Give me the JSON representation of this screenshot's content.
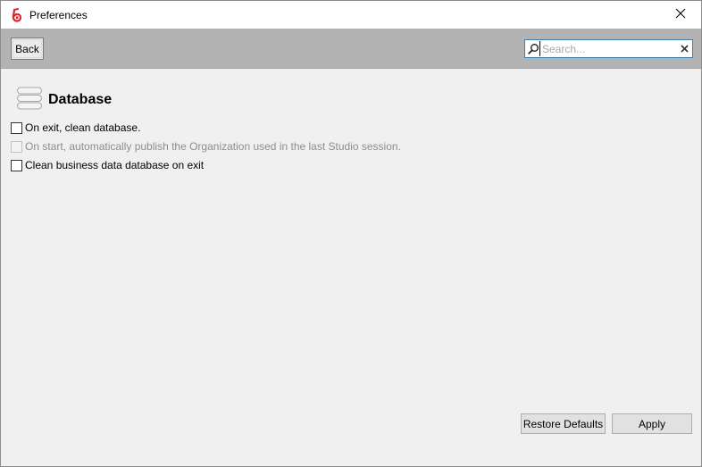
{
  "window": {
    "title": "Preferences"
  },
  "toolbar": {
    "back_label": "Back",
    "search": {
      "placeholder": "Search...",
      "value": ""
    }
  },
  "page": {
    "title": "Database",
    "options": [
      {
        "label": "On exit, clean database.",
        "checked": false,
        "enabled": true
      },
      {
        "label": "On start, automatically publish the Organization used in the last Studio session.",
        "checked": false,
        "enabled": false
      },
      {
        "label": "Clean business data database on exit",
        "checked": false,
        "enabled": true
      }
    ]
  },
  "footer": {
    "restore_label": "Restore Defaults",
    "apply_label": "Apply"
  },
  "icons": {
    "app": "bonita-logo-icon",
    "close": "close-icon",
    "search": "search-icon",
    "clear": "clear-search-icon",
    "database": "database-icon"
  },
  "colors": {
    "toolbar_bg": "#b3b3b3",
    "content_bg": "#f0f0f0",
    "search_border": "#3c7fb1",
    "app_icon": "#d9262c"
  }
}
